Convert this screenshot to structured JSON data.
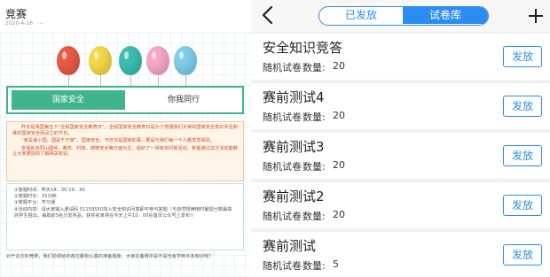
{
  "left": {
    "title": "竞赛",
    "date": "2020-4-16",
    "date_more": "…",
    "tabs": [
      "国家安全",
      "你我同行"
    ],
    "info": [
      "昨天是我国第五个“全民国家安全教育日”，全民国家安全教育日是为了增强我们大家的国家安全意识并且和维护国家安全而设立的节日。",
      "“家是最小国，国是千万家”，国家安全，不仅仅是国家的事，更是与我们每一个人都息息相关。",
      "安保处协同山图师、教务、科技、德德安全等方面为主，组织了一场有奖问答活动，希望通过这次活动能够让大家更加的了解相关知识。"
    ],
    "rules": [
      "①答题时间：昨天18：30-19：30",
      "②答题时长：15分钟",
      "③答题平台：学习通",
      "④活动内容：请大家输入邀请码 51159550加入安全知识问答即可参与答题（与自然规律用时最短分数最高的学生胜出，抽取前5名分发奖品，获奖名单将在今天上午10：00在首页公众号上发布!）"
    ],
    "outro": "对于这次的竞赛，我们协助给的各位都有认真的准备题库，大家在备赛中是不是也有学到许多知识呢？"
  },
  "balloon_colors": [
    "#e85a45",
    "#f5d848",
    "#3cbdb0",
    "#f7a6c8",
    "#7fcdea"
  ],
  "right": {
    "tabs": {
      "issued": "已发放",
      "library": "试卷库",
      "active": "library"
    },
    "icons": {
      "back": "back-chevron-icon",
      "add": "plus-icon"
    },
    "papers": [
      {
        "name": "安全知识竞答",
        "type": "随机试卷",
        "qty_label": "数量:",
        "qty": "20",
        "action": "发放"
      },
      {
        "name": "赛前测试4",
        "type": "随机试卷",
        "qty_label": "数量:",
        "qty": "20",
        "action": "发放"
      },
      {
        "name": "赛前测试3",
        "type": "随机试卷",
        "qty_label": "数量:",
        "qty": "20",
        "action": "发放"
      },
      {
        "name": "赛前测试2",
        "type": "随机试卷",
        "qty_label": "数量:",
        "qty": "20",
        "action": "发放"
      },
      {
        "name": "赛前测试",
        "type": "随机试卷",
        "qty_label": "数量:",
        "qty": "5",
        "action": "发放"
      }
    ]
  },
  "accent": "#2d8cf0",
  "green_accent": "#3fb48d"
}
